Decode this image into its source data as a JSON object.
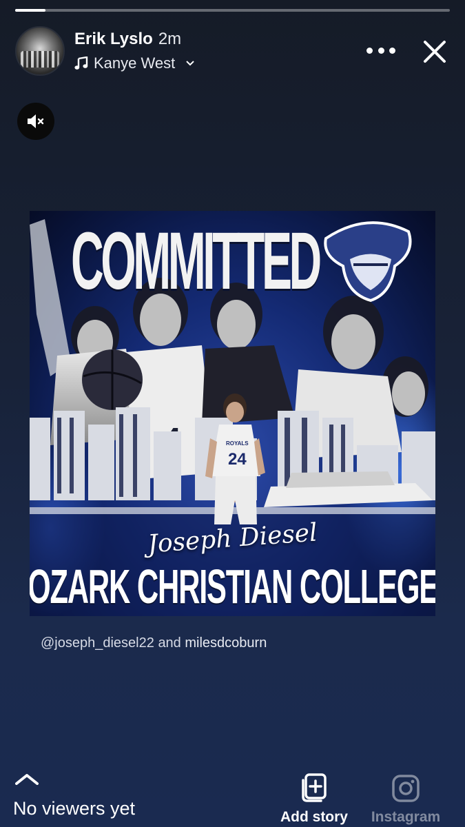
{
  "story": {
    "progress_fraction": 0.07,
    "user": {
      "name": "Erik Lyslo",
      "time": "2m"
    },
    "music": {
      "artist": "Kanye West",
      "icon": "music-note-icon"
    },
    "controls": {
      "more_icon": "ellipsis-icon",
      "close_icon": "close-icon",
      "mute_icon": "speaker-muted-icon"
    }
  },
  "poster": {
    "headline": "COMMITTED",
    "name": "Joseph Diesel",
    "college": "OZARK CHRISTIAN COLLEGE",
    "jersey_number": "24",
    "jersey_text": "ROYALS",
    "colors": {
      "navy": "#0a1640",
      "blue": "#2c4aa8"
    }
  },
  "mentions": {
    "first": "@joseph_diesel22",
    "joiner": "and",
    "second": "milesdcoburn"
  },
  "footer": {
    "viewers": "No viewers yet",
    "add_story": "Add story",
    "instagram": "Instagram"
  }
}
